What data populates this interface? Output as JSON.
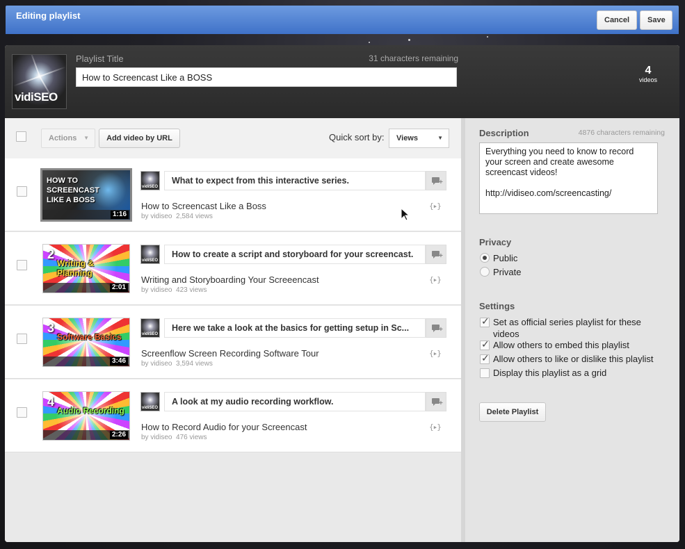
{
  "topbar": {
    "title": "Editing playlist",
    "cancel_label": "Cancel",
    "save_label": "Save"
  },
  "header": {
    "logo_text": "vidiSEO",
    "playlist_title_label": "Playlist Title",
    "chars_remaining": "31 characters remaining",
    "playlist_title_value": "How to Screencast Like a BOSS",
    "video_count": "4",
    "video_count_label": "videos"
  },
  "toolbar": {
    "actions_label": "Actions",
    "add_video_label": "Add video by URL",
    "quick_sort_label": "Quick sort by:",
    "sort_value": "Views"
  },
  "videos": [
    {
      "note": "What to expect from this interactive series.",
      "title": "How to Screencast Like a Boss",
      "channel": "by vidiseo",
      "views": "2,584 views",
      "duration": "1:16",
      "thumb_num": "",
      "thumb_caption": "HOW TO SCREENCAST LIKE A BOSS",
      "selected": true
    },
    {
      "note": "How to create a script and storyboard for your screencast.",
      "title": "Writing and Storyboarding Your Screeencast",
      "channel": "by vidiseo",
      "views": "423 views",
      "duration": "2:01",
      "thumb_num": "2",
      "thumb_caption": "Writing & Planning",
      "selected": false
    },
    {
      "note": "Here we take a look at the basics for getting setup in Sc...",
      "title": "Screenflow Screen Recording Software Tour",
      "channel": "by vidiseo",
      "views": "3,594 views",
      "duration": "3:46",
      "thumb_num": "3",
      "thumb_caption": "Software Basics",
      "selected": false
    },
    {
      "note": "A look at my audio recording workflow.",
      "title": "How to Record Audio for your Screencast",
      "channel": "by vidiseo",
      "views": "476 views",
      "duration": "2:26",
      "thumb_num": "4",
      "thumb_caption": "Audio Recording",
      "selected": false
    }
  ],
  "embed_glyph": "{▸}",
  "sidebar": {
    "description_label": "Description",
    "description_remaining": "4876 characters remaining",
    "description_value": "Everything you need to know to record your screen and create awesome screencast videos!\n\nhttp://vidiseo.com/screencasting/",
    "privacy_label": "Privacy",
    "privacy_options": [
      "Public",
      "Private"
    ],
    "privacy_selected": "Public",
    "settings_label": "Settings",
    "settings": [
      {
        "label": "Set as official series playlist for these videos",
        "checked": true
      },
      {
        "label": "Allow others to embed this playlist",
        "checked": true
      },
      {
        "label": "Allow others to like or dislike this playlist",
        "checked": true
      },
      {
        "label": "Display this playlist as a grid",
        "checked": false
      }
    ],
    "delete_label": "Delete Playlist"
  },
  "colors": {
    "topbar_top": "#6d9be0",
    "topbar_bottom": "#3f72c8",
    "header_bg": "#2a2a2a"
  }
}
